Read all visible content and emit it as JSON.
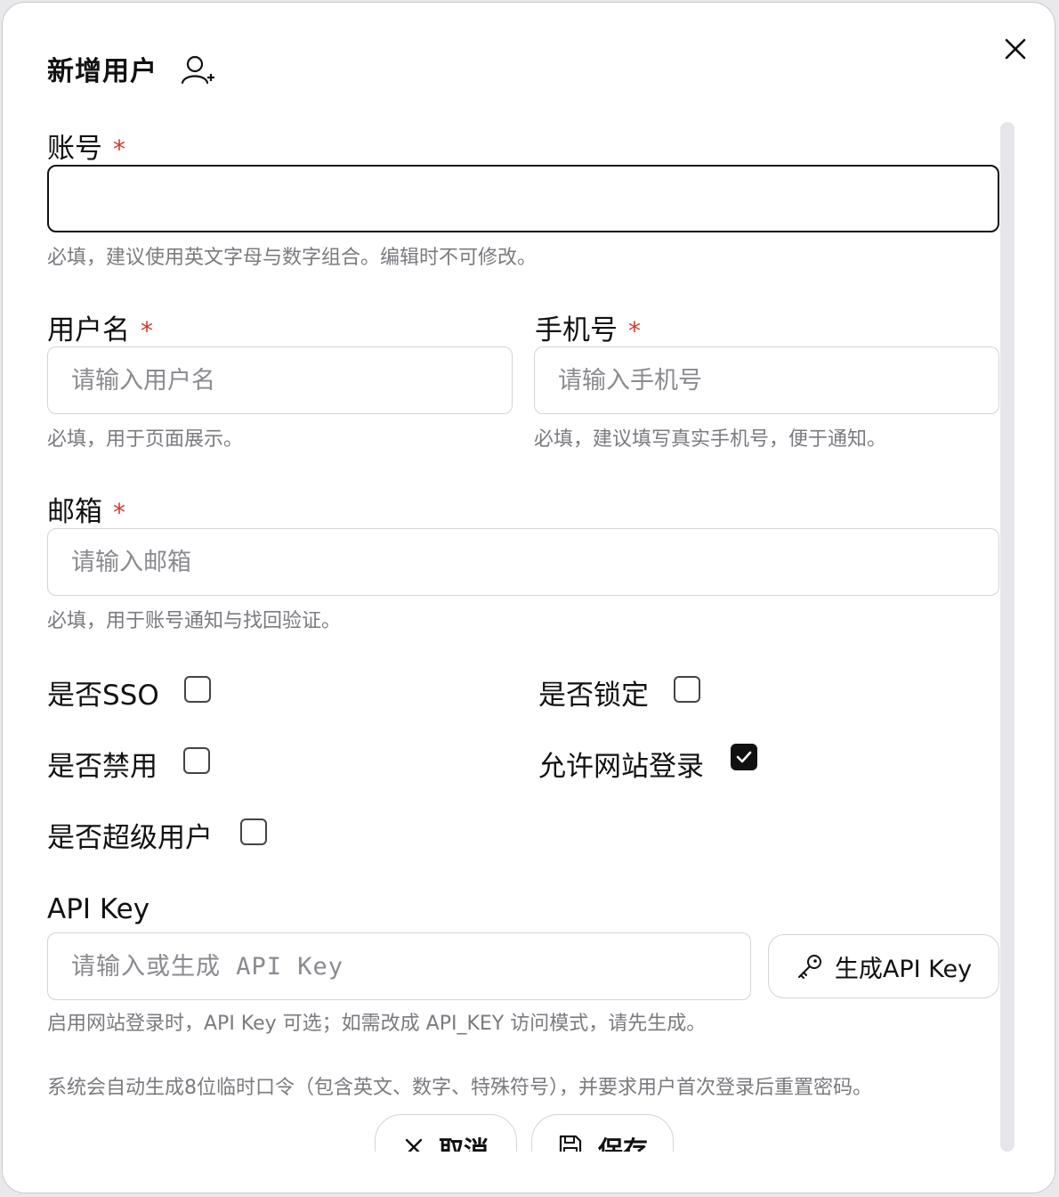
{
  "dialog": {
    "title": "新增用户",
    "title_icon": "user-plus-icon",
    "close_icon": "close-icon"
  },
  "account": {
    "label": "账号",
    "required_mark": "*",
    "value": "",
    "placeholder": "",
    "help": "必填，建议使用英文字母与数字组合。编辑时不可修改。"
  },
  "username": {
    "label": "用户名",
    "required_mark": "*",
    "placeholder": "请输入用户名",
    "help": "必填，用于页面展示。"
  },
  "phone": {
    "label": "手机号",
    "required_mark": "*",
    "placeholder": "请输入手机号",
    "help": "必填，建议填写真实手机号，便于通知。"
  },
  "email": {
    "label": "邮箱",
    "required_mark": "*",
    "placeholder": "请输入邮箱",
    "help": "必填，用于账号通知与找回验证。"
  },
  "options": {
    "sso": {
      "label": "是否SSO",
      "checked": false
    },
    "locked": {
      "label": "是否锁定",
      "checked": false
    },
    "disabled": {
      "label": "是否禁用",
      "checked": false
    },
    "allow_web_login": {
      "label": "允许网站登录",
      "checked": true
    },
    "superuser": {
      "label": "是否超级用户",
      "checked": false
    }
  },
  "api_key": {
    "label": "API Key",
    "placeholder": "请输入或生成 API Key",
    "generate_label": "生成API Key",
    "generate_icon": "key-icon",
    "help": "启用网站登录时，API Key 可选；如需改成 API_KEY 访问模式，请先生成。"
  },
  "notice": "系统会自动生成8位临时口令（包含英文、数字、特殊符号），并要求用户首次登录后重置密码。",
  "footer": {
    "cancel_label": "取消",
    "cancel_icon": "close-icon",
    "save_label": "保存",
    "save_icon": "save-icon"
  },
  "colors": {
    "required": "#d23a2e",
    "help_text": "#7a7a80",
    "border": "#d4d4d8",
    "checked": "#111111"
  }
}
